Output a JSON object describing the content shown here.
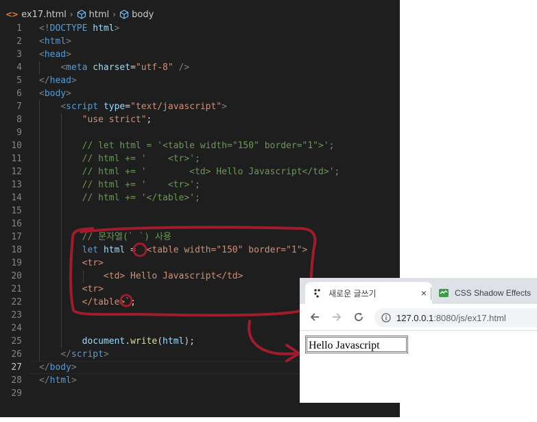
{
  "breadcrumb": {
    "file": "ex17.html",
    "items": [
      "html",
      "body"
    ]
  },
  "code_lines": [
    {
      "n": "1",
      "parts": [
        [
          "bracket",
          "<!"
        ],
        [
          "tag",
          "DOCTYPE"
        ],
        [
          "plain",
          " "
        ],
        [
          "attr",
          "html"
        ],
        [
          "bracket",
          ">"
        ]
      ]
    },
    {
      "n": "2",
      "parts": [
        [
          "bracket",
          "<"
        ],
        [
          "tag",
          "html"
        ],
        [
          "bracket",
          ">"
        ]
      ]
    },
    {
      "n": "3",
      "parts": [
        [
          "bracket",
          "<"
        ],
        [
          "tag",
          "head"
        ],
        [
          "bracket",
          ">"
        ]
      ]
    },
    {
      "n": "4",
      "parts": [
        [
          "plain",
          "    "
        ],
        [
          "bracket",
          "<"
        ],
        [
          "tag",
          "meta"
        ],
        [
          "plain",
          " "
        ],
        [
          "attr",
          "charset"
        ],
        [
          "plain",
          "="
        ],
        [
          "str",
          "\"utf-8\""
        ],
        [
          "plain",
          " "
        ],
        [
          "bracket",
          "/>"
        ]
      ]
    },
    {
      "n": "5",
      "parts": [
        [
          "bracket",
          "</"
        ],
        [
          "tag",
          "head"
        ],
        [
          "bracket",
          ">"
        ]
      ]
    },
    {
      "n": "6",
      "parts": [
        [
          "bracket",
          "<"
        ],
        [
          "tag",
          "body"
        ],
        [
          "bracket",
          ">"
        ]
      ]
    },
    {
      "n": "7",
      "parts": [
        [
          "plain",
          "    "
        ],
        [
          "bracket",
          "<"
        ],
        [
          "tag",
          "script"
        ],
        [
          "plain",
          " "
        ],
        [
          "attr",
          "type"
        ],
        [
          "plain",
          "="
        ],
        [
          "str",
          "\"text/javascript\""
        ],
        [
          "bracket",
          ">"
        ]
      ]
    },
    {
      "n": "8",
      "parts": [
        [
          "plain",
          "        "
        ],
        [
          "str",
          "\"use strict\""
        ],
        [
          "plain",
          ";"
        ]
      ]
    },
    {
      "n": "9",
      "parts": []
    },
    {
      "n": "10",
      "parts": [
        [
          "plain",
          "        "
        ],
        [
          "cmt",
          "// let html = '<table width=\"150\" border=\"1\">';"
        ]
      ]
    },
    {
      "n": "11",
      "parts": [
        [
          "plain",
          "        "
        ],
        [
          "cmt",
          "// html += '    <tr>';"
        ]
      ]
    },
    {
      "n": "12",
      "parts": [
        [
          "plain",
          "        "
        ],
        [
          "cmt",
          "// html += '        <td> Hello Javascript</td>';"
        ]
      ]
    },
    {
      "n": "13",
      "parts": [
        [
          "plain",
          "        "
        ],
        [
          "cmt",
          "// html += '    <tr>';"
        ]
      ]
    },
    {
      "n": "14",
      "parts": [
        [
          "plain",
          "        "
        ],
        [
          "cmt",
          "// html += '</table>';"
        ]
      ]
    },
    {
      "n": "15",
      "parts": []
    },
    {
      "n": "16",
      "parts": []
    },
    {
      "n": "17",
      "parts": [
        [
          "plain",
          "        "
        ],
        [
          "cmt",
          "// 문자열(` `) 사용"
        ]
      ]
    },
    {
      "n": "18",
      "parts": [
        [
          "plain",
          "        "
        ],
        [
          "kw",
          "let"
        ],
        [
          "plain",
          " "
        ],
        [
          "var",
          "html"
        ],
        [
          "plain",
          " = "
        ],
        [
          "str",
          "`<table width=\"150\" border=\"1\">"
        ]
      ]
    },
    {
      "n": "19",
      "parts": [
        [
          "plain",
          "        "
        ],
        [
          "str",
          "<tr>"
        ]
      ]
    },
    {
      "n": "20",
      "parts": [
        [
          "plain",
          "            "
        ],
        [
          "str",
          "<td> Hello Javascript</td>"
        ]
      ]
    },
    {
      "n": "21",
      "parts": [
        [
          "plain",
          "        "
        ],
        [
          "str",
          "<tr>"
        ]
      ]
    },
    {
      "n": "22",
      "parts": [
        [
          "plain",
          "        "
        ],
        [
          "str",
          "</table>`"
        ],
        [
          "plain",
          ";"
        ]
      ]
    },
    {
      "n": "23",
      "parts": []
    },
    {
      "n": "24",
      "parts": []
    },
    {
      "n": "25",
      "parts": [
        [
          "plain",
          "        "
        ],
        [
          "var",
          "document"
        ],
        [
          "plain",
          "."
        ],
        [
          "fn",
          "write"
        ],
        [
          "plain",
          "("
        ],
        [
          "var",
          "html"
        ],
        [
          "plain",
          ");"
        ]
      ]
    },
    {
      "n": "26",
      "parts": [
        [
          "plain",
          "    "
        ],
        [
          "bracket",
          "</"
        ],
        [
          "tag",
          "script"
        ],
        [
          "bracket",
          ">"
        ]
      ]
    },
    {
      "n": "27",
      "parts": [
        [
          "bracket",
          "</"
        ],
        [
          "tag",
          "body"
        ],
        [
          "bracket",
          ">"
        ]
      ]
    },
    {
      "n": "28",
      "parts": [
        [
          "bracket",
          "</"
        ],
        [
          "tag",
          "html"
        ],
        [
          "bracket",
          ">"
        ]
      ]
    },
    {
      "n": "29",
      "parts": []
    }
  ],
  "browser": {
    "tab_active_title": "새로운 글쓰기",
    "tab_close": "×",
    "tab_inactive_title": "CSS Shadow Effects",
    "url_host": "127.0.0.1",
    "url_path": ":8080/js/ex17.html",
    "page_cell_text": "Hello Javascript"
  },
  "colors": {
    "editor_bg": "#1e1e1e",
    "annotation": "#a01c2c",
    "tab_bar": "#dee1e6"
  }
}
